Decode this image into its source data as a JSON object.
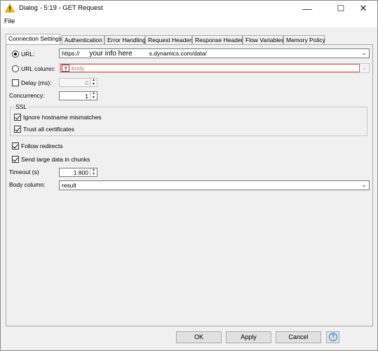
{
  "window": {
    "title": "Dialog - 5:19 - GET Request",
    "minimize": "—",
    "maximize": "☐",
    "close": "✕"
  },
  "menu": {
    "file": "File"
  },
  "tabs": [
    "Connection Settings",
    "Authentication",
    "Error Handling",
    "Request Headers",
    "Response Headers",
    "Flow Variables",
    "Memory Policy"
  ],
  "form": {
    "url_label": "URL:",
    "url_value_prefix": "https://",
    "url_overlay": "your info here",
    "url_value_suffix": "s.dynamics.com/data/",
    "url_column_label": "URL column:",
    "url_column_value": "body",
    "url_column_icon": "?",
    "delay_label": "Delay (ms):",
    "delay_value": "0",
    "concurrency_label": "Concurrency:",
    "concurrency_value": "1",
    "ssl_title": "SSL",
    "ignore_hostname_label": "Ignore hostname mismatches",
    "trust_certs_label": "Trust all certificates",
    "follow_redirects_label": "Follow redirects",
    "send_chunks_label": "Send large data in chunks",
    "timeout_label": "Timeout (s)",
    "timeout_value": "1 800",
    "body_column_label": "Body column:",
    "body_column_value": "result"
  },
  "state": {
    "url_radio_selected": true,
    "delay_checked": false,
    "ignore_hostname_checked": true,
    "trust_certs_checked": true,
    "follow_redirects_checked": true,
    "send_chunks_checked": true
  },
  "buttons": {
    "ok": "OK",
    "apply": "Apply",
    "cancel": "Cancel",
    "help": "?"
  },
  "colors": {
    "warning_icon": "#f2c200",
    "error_border": "#d9534f",
    "help_blue": "#2f7fcf"
  },
  "icons": {
    "title": "warning-triangle-icon",
    "dropdown": "chevron-down-icon"
  }
}
